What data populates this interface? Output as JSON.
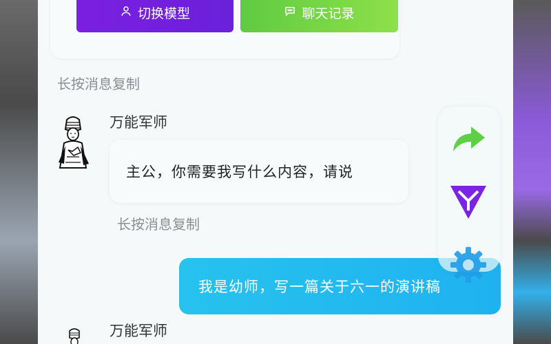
{
  "toolbar": {
    "switch_model": "切换模型",
    "chat_history": "聊天记录"
  },
  "hints": {
    "long_press_copy_1": "长按消息复制",
    "long_press_copy_2": "长按消息复制"
  },
  "messages": [
    {
      "sender": "万能军师",
      "role": "bot",
      "text": "主公，你需要我写什么内容，请说"
    },
    {
      "role": "user",
      "text": "我是幼师，写一篇关于六一的演讲稿"
    },
    {
      "sender": "万能军师",
      "role": "bot",
      "text": ""
    }
  ],
  "colors": {
    "switch_button": "#7b1fe0",
    "history_button": "#6cd344",
    "user_bubble": "#22bbf0",
    "share_icon": "#5fcf47",
    "logo_icon": "#7a24e4",
    "gear_icon": "#1f9ee8"
  },
  "icons": {
    "switch_model": "user-icon",
    "chat_history": "chat-bubble-icon",
    "share": "share-arrow-icon",
    "logo": "triangle-logo-icon",
    "settings": "gear-icon"
  }
}
